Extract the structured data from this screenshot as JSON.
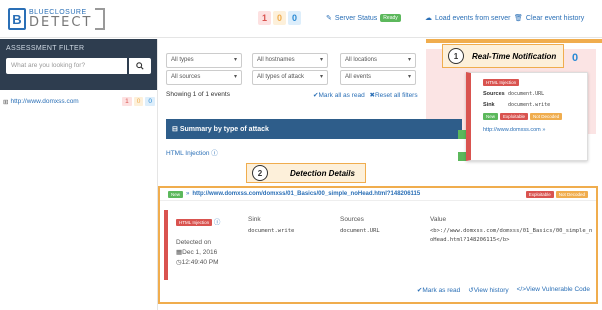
{
  "brand": {
    "line1": "BLUECLOSURE",
    "line2": "DETECT",
    "mark": "B"
  },
  "top_counts": {
    "red": "1",
    "orange": "0",
    "blue": "0"
  },
  "top_links": {
    "server_status": "Server Status",
    "server_status_badge": "Ready",
    "load_events": "Load events from server",
    "clear_history": "Clear event history"
  },
  "sidebar": {
    "title": "ASSESSMENT FILTER",
    "search_placeholder": "What are you looking for?",
    "items": [
      {
        "label": "http://www.domxss.com",
        "red": "1",
        "orange": "0",
        "blue": "0"
      }
    ]
  },
  "filters": {
    "row1": [
      "All types",
      "All hostnames",
      "All locations"
    ],
    "row2": [
      "All sources",
      "All types of attack",
      "All events"
    ]
  },
  "showing": "Showing 1 of 1 events",
  "mark_all_read": "Mark all as read",
  "reset_filters": "Reset all filters",
  "summary": {
    "title": "Summary by type of attack",
    "item": "HTML Injection"
  },
  "callout1": {
    "num": "1",
    "title": "Real-Time Notification",
    "count": "0"
  },
  "notification": {
    "tag": "HTML Injection",
    "sources_label": "Sources",
    "sources_value": "document.URL",
    "sink_label": "Sink",
    "sink_value": "document.write",
    "tags": [
      "New",
      "Exploitable",
      "Not Decoded"
    ],
    "url": "http://www.domxss.com"
  },
  "callout2": {
    "num": "2",
    "title": "Detection Details"
  },
  "detail": {
    "new": "New",
    "url": "http://www.domxss.com/domxss/01_Basics/00_simple_noHead.html?148206115",
    "tags": [
      "Exploitable",
      "Not Decoded"
    ],
    "tag": "HTML Injection",
    "detected_on": "Detected on",
    "date": "Dec 1, 2016",
    "time": "12:49:40 PM",
    "sink_label": "Sink",
    "sink_value": "document.write",
    "sources_label": "Sources",
    "sources_value": "document.URL",
    "value_label": "Value",
    "value_line1": "<b>://www.domxss.com/domxss/01_Basics/00_simple_n",
    "value_line2": "oHead.html?148206115</b>",
    "actions": [
      "Mark as read",
      "View history",
      "View Vulnerable Code"
    ]
  },
  "colors": {
    "red": "#d9534f",
    "orange": "#f0ad4e",
    "blue": "#2a8ad4",
    "green": "#5cb85c",
    "navy": "#2e3d4f"
  }
}
